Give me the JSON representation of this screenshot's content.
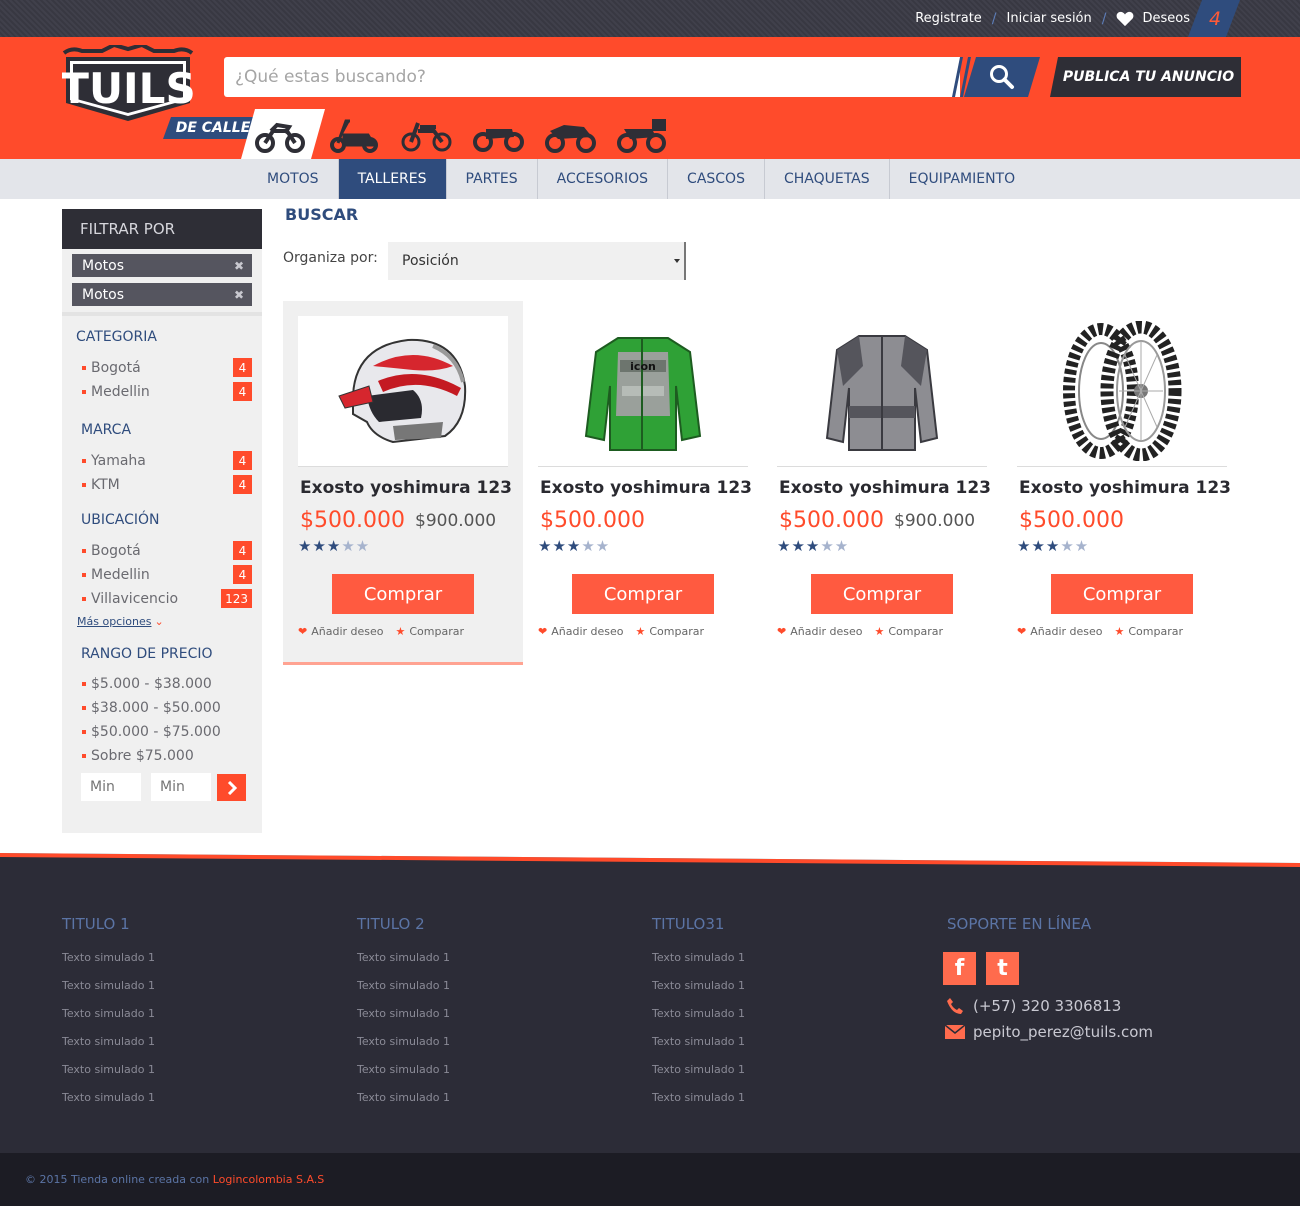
{
  "topbar": {
    "register": "Registrate",
    "login": "Iniciar sesión",
    "wishlist": "Deseos",
    "wishlist_count": "4"
  },
  "header": {
    "logo_text": "TUILS",
    "logo_tag": "DE CALLE",
    "search_placeholder": "¿Qué estas buscando?",
    "publish_label": "PUBLICA TU ANUNCIO",
    "categories_icons": [
      "motorcycle-street-icon",
      "scooter-icon",
      "dirtbike-icon",
      "cruiser-icon",
      "sportbike-icon",
      "touring-icon"
    ]
  },
  "nav": {
    "items": [
      {
        "label": "MOTOS",
        "active": false
      },
      {
        "label": "TALLERES",
        "active": true
      },
      {
        "label": "PARTES",
        "active": false
      },
      {
        "label": "ACCESORIOS",
        "active": false
      },
      {
        "label": "CASCOS",
        "active": false
      },
      {
        "label": "CHAQUETAS",
        "active": false
      },
      {
        "label": "EQUIPAMIENTO",
        "active": false
      }
    ]
  },
  "sidebar": {
    "title": "FILTRAR POR",
    "chips": [
      "Motos",
      "Motos"
    ],
    "categoria": {
      "title": "CATEGORIA",
      "items": [
        {
          "label": "Bogotá",
          "count": "4"
        },
        {
          "label": "Medellin",
          "count": "4"
        }
      ]
    },
    "marca": {
      "title": "MARCA",
      "items": [
        {
          "label": "Yamaha",
          "count": "4"
        },
        {
          "label": "KTM",
          "count": "4"
        }
      ]
    },
    "ubicacion": {
      "title": "UBICACIÓN",
      "items": [
        {
          "label": "Bogotá",
          "count": "4"
        },
        {
          "label": "Medellin",
          "count": "4"
        },
        {
          "label": "Villavicencio",
          "count": "123"
        }
      ]
    },
    "more_label": "Más opciones",
    "precio": {
      "title": "RANGO DE PRECIO",
      "items": [
        "$5.000 - $38.000",
        "$38.000 - $50.000",
        "$50.000 - $75.000",
        "Sobre $75.000"
      ]
    },
    "min_placeholder_1": "Min",
    "min_placeholder_2": "Min"
  },
  "main": {
    "title": "BUSCAR",
    "sort_label": "Organiza por:",
    "sort_value": "Posición",
    "products": [
      {
        "name": "Exosto yoshimura 123",
        "price": "$500.000",
        "old_price": "$900.000",
        "rating": 3,
        "buy": "Comprar",
        "wish": "Añadir deseo",
        "compare": "Comparar",
        "image": "helmet"
      },
      {
        "name": "Exosto yoshimura 123",
        "price": "$500.000",
        "old_price": "",
        "rating": 3,
        "buy": "Comprar",
        "wish": "Añadir deseo",
        "compare": "Comparar",
        "image": "green-jacket"
      },
      {
        "name": "Exosto yoshimura 123",
        "price": "$500.000",
        "old_price": "$900.000",
        "rating": 3,
        "buy": "Comprar",
        "wish": "Añadir deseo",
        "compare": "Comparar",
        "image": "gray-jacket"
      },
      {
        "name": "Exosto yoshimura 123",
        "price": "$500.000",
        "old_price": "",
        "rating": 3,
        "buy": "Comprar",
        "wish": "Añadir deseo",
        "compare": "Comparar",
        "image": "tires"
      }
    ]
  },
  "footer": {
    "columns": [
      {
        "title": "TITULO 1",
        "links": [
          "Texto simulado 1",
          "Texto simulado 1",
          "Texto simulado 1",
          "Texto simulado 1",
          "Texto simulado 1",
          "Texto simulado 1"
        ]
      },
      {
        "title": "TITULO 2",
        "links": [
          "Texto simulado 1",
          "Texto simulado 1",
          "Texto simulado 1",
          "Texto simulado 1",
          "Texto simulado 1",
          "Texto simulado 1"
        ]
      },
      {
        "title": "TITULO31",
        "links": [
          "Texto simulado 1",
          "Texto simulado 1",
          "Texto simulado 1",
          "Texto simulado 1",
          "Texto simulado 1",
          "Texto simulado 1"
        ]
      }
    ],
    "support_title": "SOPORTE EN LÍNEA",
    "phone": "(+57) 320 3306813",
    "email": "pepito_perez@tuils.com",
    "copyright": "© 2015 Tienda online creada con ",
    "brand": "Logincolombia S.A.S"
  },
  "colors": {
    "accent": "#ff4b2b",
    "navy": "#2f4c7d",
    "dark": "#2c2c37"
  }
}
